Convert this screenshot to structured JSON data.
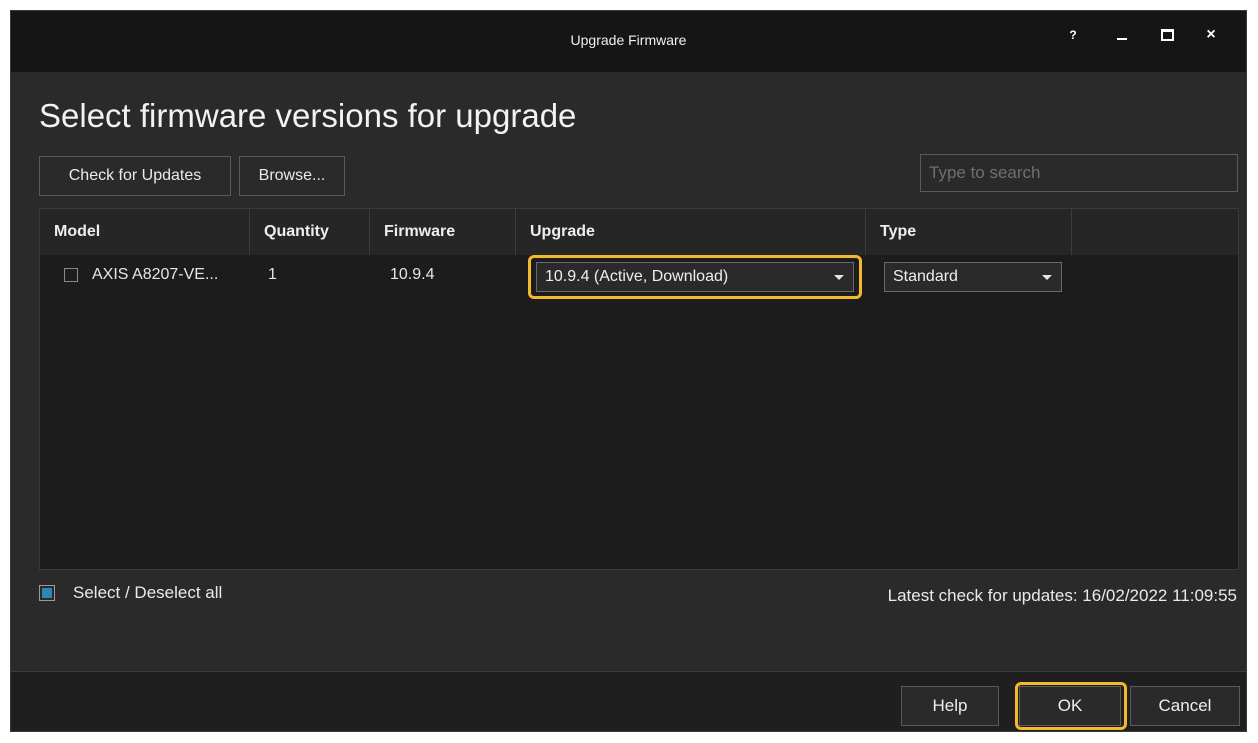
{
  "window": {
    "title": "Upgrade Firmware",
    "help_glyph": "?",
    "close_glyph": "×"
  },
  "heading": "Select firmware versions for upgrade",
  "toolbar": {
    "check_updates_label": "Check for Updates",
    "browse_label": "Browse...",
    "search_placeholder": "Type to search"
  },
  "grid": {
    "columns": [
      "Model",
      "Quantity",
      "Firmware",
      "Upgrade",
      "Type"
    ],
    "rows": [
      {
        "checked": false,
        "model": "AXIS A8207-VE...",
        "quantity": "1",
        "firmware": "10.9.4",
        "upgrade": "10.9.4 (Active, Download)",
        "type": "Standard"
      }
    ]
  },
  "select_all": {
    "label": "Select / Deselect all",
    "checked": true
  },
  "latest_check": "Latest check for updates: 16/02/2022 11:09:55",
  "footer": {
    "help_label": "Help",
    "ok_label": "OK",
    "cancel_label": "Cancel"
  },
  "colors": {
    "highlight": "#f2b92c",
    "checkbox_fill": "#2f86b5",
    "background": "#2a2a2a"
  }
}
